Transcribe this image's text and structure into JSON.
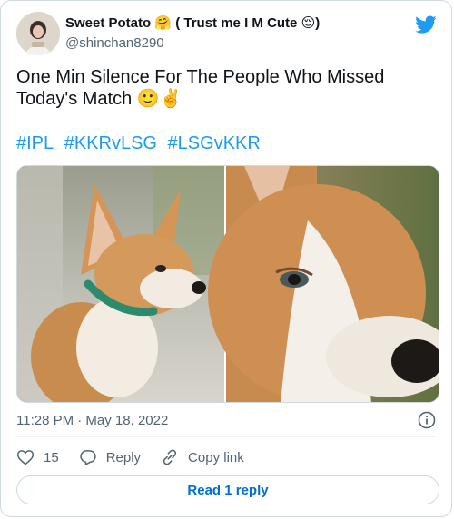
{
  "author": {
    "name": "Sweet Potato",
    "name_emoji": "🤗",
    "tagline": "( Trust me I M Cute",
    "tagline_emoji": "😌",
    "tagline_close": ")",
    "handle": "@shinchan8290"
  },
  "tweet": {
    "line1": "One Min Silence For The People Who Missed",
    "line2": "Today's Match 🙂✌️",
    "hashtags": [
      "#IPL",
      "#KKRvLSG",
      "#LSGvKKR"
    ]
  },
  "meta": {
    "timestamp": "11:28 PM · May 18, 2022"
  },
  "actions": {
    "like_count": "15",
    "reply_label": "Reply",
    "copy_link_label": "Copy link"
  },
  "read_replies_label": "Read 1 reply",
  "colors": {
    "accent": "#1d9bf0",
    "link_button": "#006fd6",
    "muted_text": "#536471",
    "border": "#cfd9de"
  },
  "icons": {
    "brand": "twitter-bird-icon",
    "info": "info-icon",
    "like": "heart-icon",
    "reply": "reply-bubble-icon",
    "copy_link": "link-icon"
  }
}
